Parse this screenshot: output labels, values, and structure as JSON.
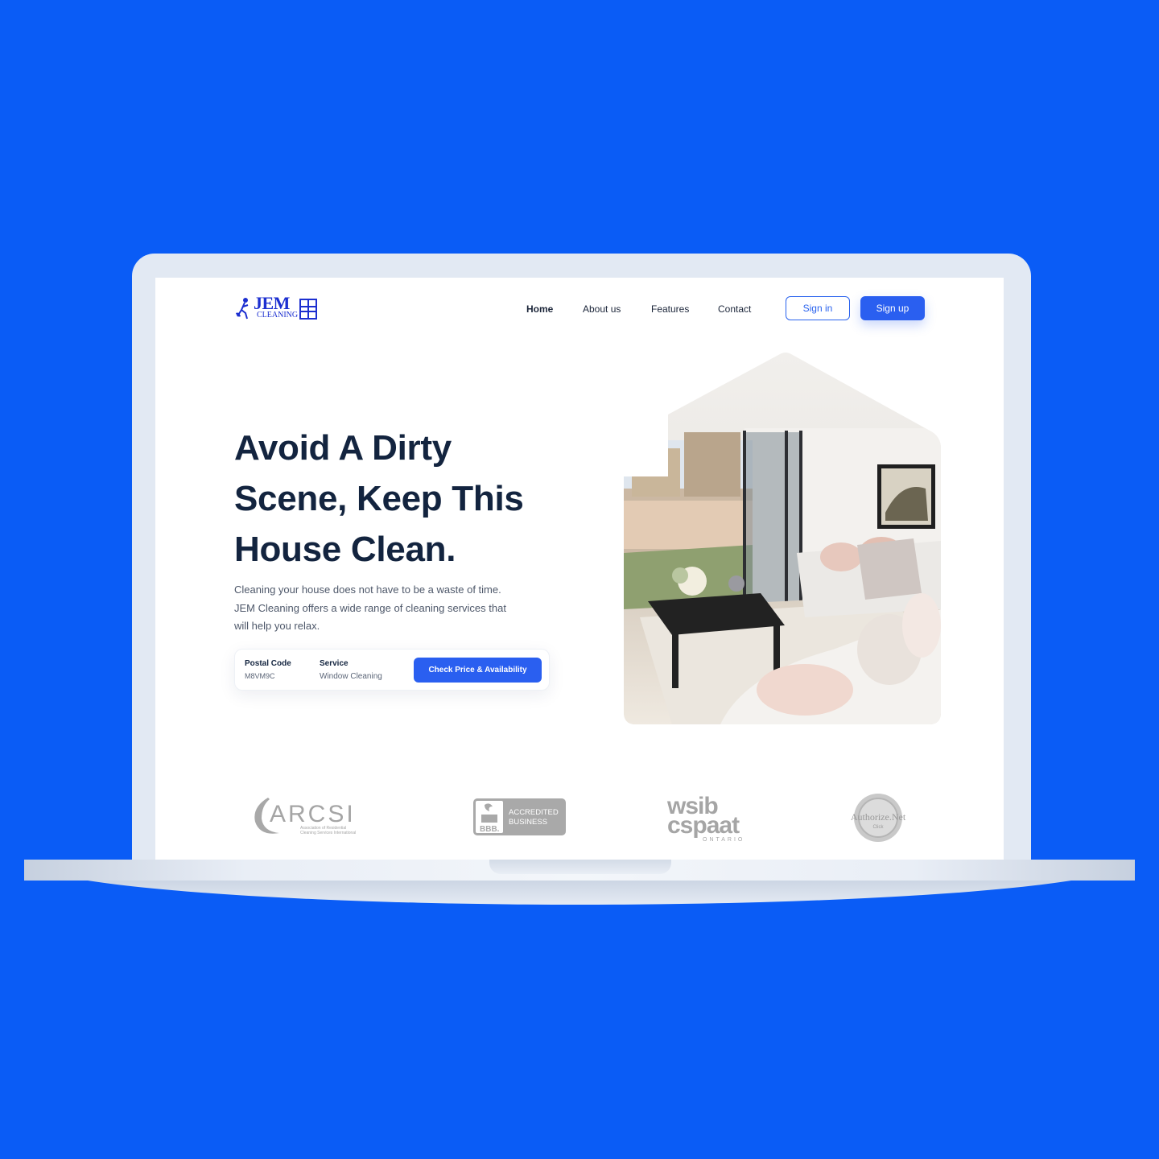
{
  "brand": {
    "name": "JEM",
    "sub": "CLEANING",
    "color": "#1c2fd0"
  },
  "nav": {
    "links": [
      "Home",
      "About us",
      "Features",
      "Contact"
    ],
    "sign_in": "Sign in",
    "sign_up": "Sign up"
  },
  "hero": {
    "title_lines": [
      "Avoid A Dirty",
      "Scene, Keep This",
      "House Clean."
    ],
    "description": "Cleaning your house does not have to be a waste of time. JEM Cleaning offers a wide range of cleaning services that will help you relax."
  },
  "booking": {
    "postal_label": "Postal Code",
    "postal_value": "M8VM9C",
    "service_label": "Service",
    "service_value": "Window Cleaning",
    "cta": "Check Price &  Availability"
  },
  "partners": {
    "arcsi": {
      "name": "ARCSI",
      "sub1": "Association of Residential",
      "sub2": "Cleaning Services International"
    },
    "bbb": {
      "mark": "BBB.",
      "line1": "ACCREDITED",
      "line2": "BUSINESS"
    },
    "wsib": {
      "line1": "wsib",
      "line2": "cspaat",
      "line3": "ONTARIO"
    },
    "authorize": {
      "name": "Authorize.Net",
      "sub": "Click"
    }
  },
  "colors": {
    "background": "#0a5cf6",
    "accent": "#2a5ff0",
    "heading": "#13243f"
  }
}
